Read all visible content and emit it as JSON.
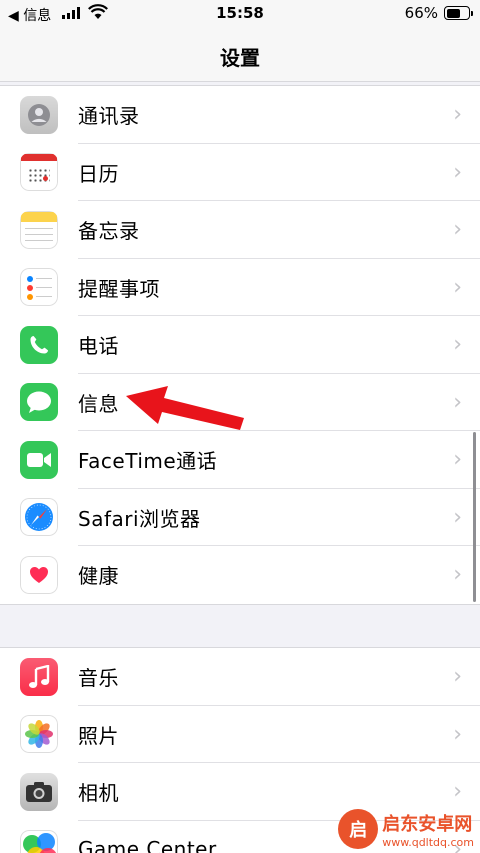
{
  "status_bar": {
    "back_label": "◀ 信息",
    "time": "15:58",
    "battery_percent": "66%",
    "battery_level": 0.66
  },
  "nav": {
    "title": "设置"
  },
  "group1": [
    {
      "label": "通讯录",
      "icon": "contacts-icon"
    },
    {
      "label": "日历",
      "icon": "calendar-icon"
    },
    {
      "label": "备忘录",
      "icon": "notes-icon"
    },
    {
      "label": "提醒事项",
      "icon": "reminders-icon"
    },
    {
      "label": "电话",
      "icon": "phone-icon"
    },
    {
      "label": "信息",
      "icon": "messages-icon"
    },
    {
      "label": "FaceTime通话",
      "icon": "facetime-icon"
    },
    {
      "label": "Safari浏览器",
      "icon": "safari-icon"
    },
    {
      "label": "健康",
      "icon": "health-icon"
    }
  ],
  "group2": [
    {
      "label": "音乐",
      "icon": "music-icon"
    },
    {
      "label": "照片",
      "icon": "photos-icon"
    },
    {
      "label": "相机",
      "icon": "camera-icon"
    },
    {
      "label": "Game Center",
      "icon": "game-center-icon"
    }
  ],
  "chevron": "›",
  "watermark": {
    "name": "启东安卓网",
    "url": "www.qdltdq.com"
  },
  "colors": {
    "phone": "#34c759",
    "messages": "#34c759",
    "facetime": "#34c759",
    "music": "#fa3c5a",
    "arrow": "#e8141b",
    "watermark": "#e9532b"
  }
}
